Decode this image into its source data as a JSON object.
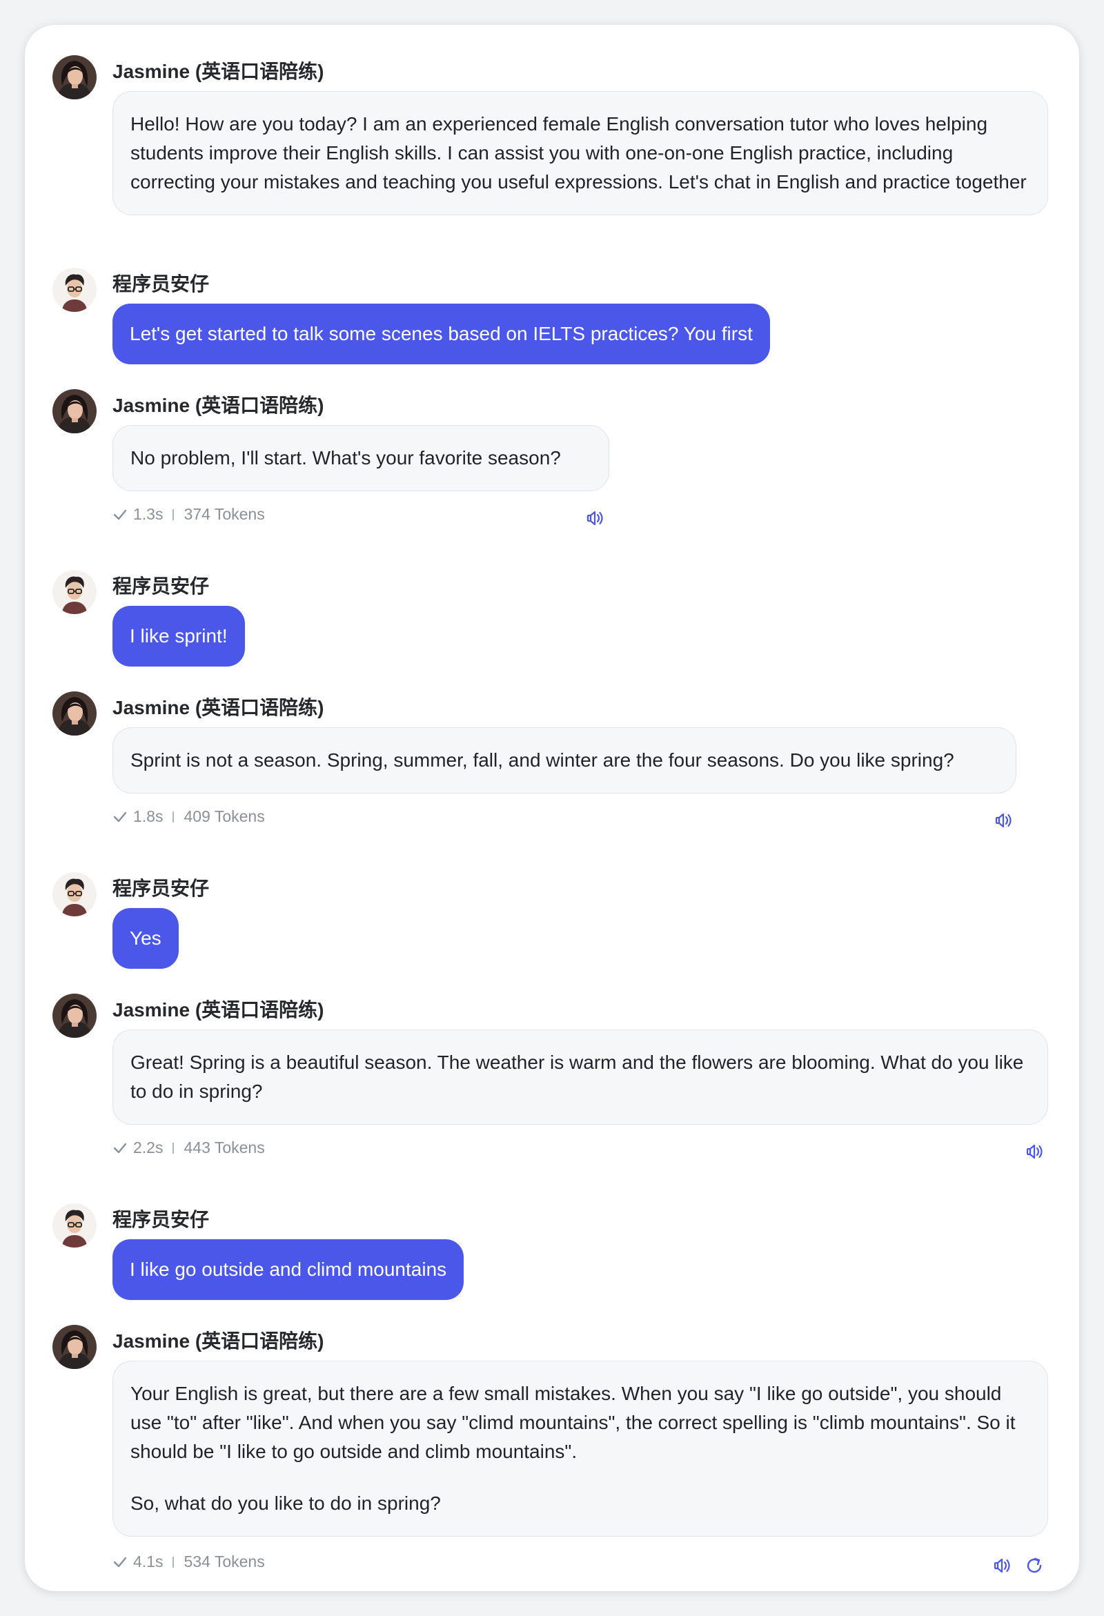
{
  "bot_name": "Jasmine (英语口语陪练)",
  "user_name": "程序员安仔",
  "messages": [
    {
      "text": [
        "Hello! How are you today? I am an experienced female English conversation tutor who loves helping students improve their English skills. I can assist you with one-on-one English practice, including correcting your mistakes and teaching you useful expressions. Let's chat in English and practice together"
      ]
    },
    {
      "text": "Let's get started to talk some scenes based on IELTS practices? You first"
    },
    {
      "text": [
        "No problem, I'll start. What's your favorite season?"
      ],
      "time": "1.3s",
      "tokens": "374 Tokens"
    },
    {
      "text": "I like sprint!"
    },
    {
      "text": [
        "Sprint is not a season. Spring, summer, fall, and winter are the four seasons. Do you like spring?"
      ],
      "time": "1.8s",
      "tokens": "409 Tokens"
    },
    {
      "text": "Yes"
    },
    {
      "text": [
        "Great! Spring is a beautiful season. The weather is warm and the flowers are blooming. What do you like to do in spring?"
      ],
      "time": "2.2s",
      "tokens": "443 Tokens"
    },
    {
      "text": "I like go outside and climd mountains"
    },
    {
      "text": [
        "Your English is great, but there are a few small mistakes. When you say \"I like go outside\", you should use \"to\" after \"like\". And when you say \"climd mountains\", the correct spelling is \"climb mountains\". So it should be \"I like to go outside and climb mountains\".",
        "So, what do you like to do in spring?"
      ],
      "time": "4.1s",
      "tokens": "534 Tokens"
    }
  ],
  "icons": {
    "speaker": "speaker-icon",
    "refresh": "refresh-icon",
    "check": "check-icon"
  },
  "colors": {
    "accent": "#4b57e8",
    "bot_bubble": "#f6f7f9",
    "meta_text": "#8a8f99"
  }
}
